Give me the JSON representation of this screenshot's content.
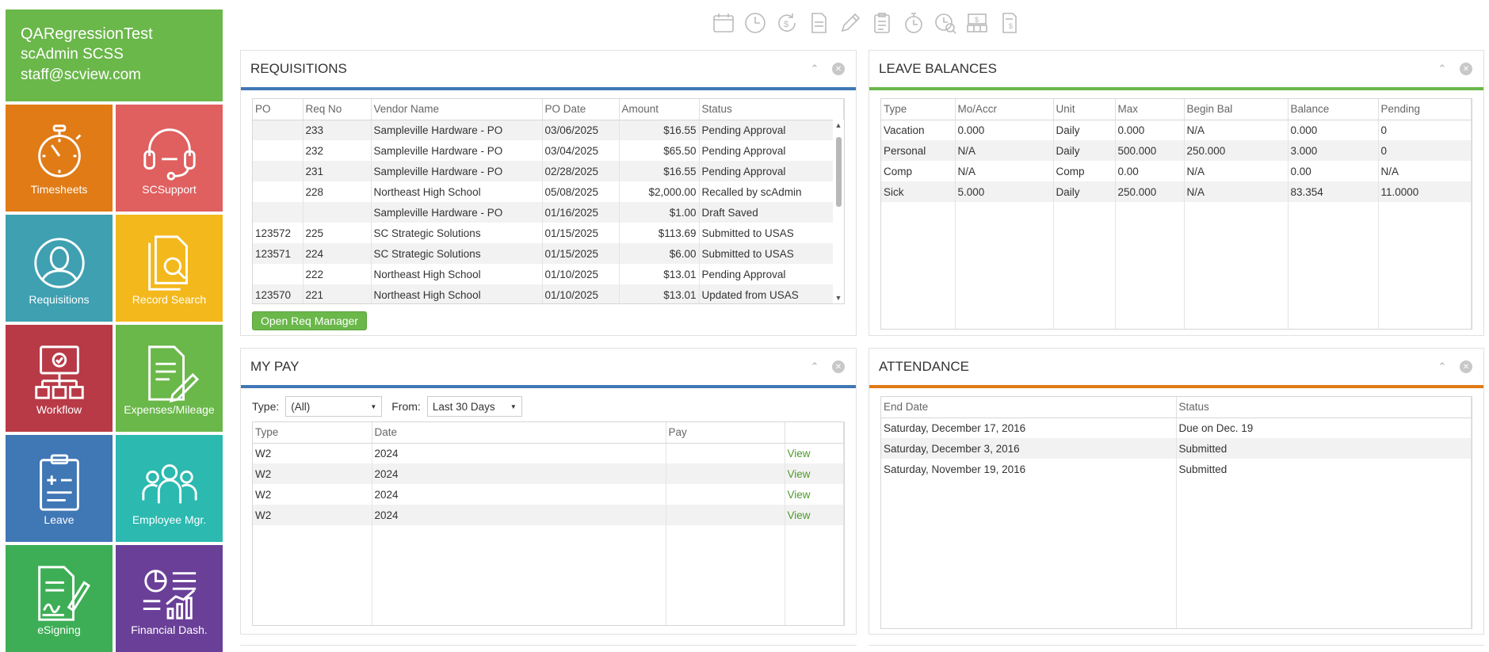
{
  "user": {
    "org": "QARegressionTest",
    "name": "scAdmin SCSS",
    "email": "staff@scview.com"
  },
  "tiles": [
    {
      "label": "Timesheets",
      "color": "#e07b16",
      "icon": "stopwatch-icon"
    },
    {
      "label": "SCSupport",
      "color": "#e05f5f",
      "icon": "headset-icon"
    },
    {
      "label": "Requisitions",
      "color": "#3ea0b1",
      "icon": "person-icon"
    },
    {
      "label": "Record Search",
      "color": "#f3b81c",
      "icon": "document-search-icon"
    },
    {
      "label": "Workflow",
      "color": "#b83a46",
      "icon": "workflow-icon"
    },
    {
      "label": "Expenses/Mileage",
      "color": "#6ab74a",
      "icon": "document-pen-icon"
    },
    {
      "label": "Leave",
      "color": "#4077b5",
      "icon": "clipboard-icon"
    },
    {
      "label": "Employee Mgr.",
      "color": "#2bb9b0",
      "icon": "group-icon"
    },
    {
      "label": "eSigning",
      "color": "#3dae55",
      "icon": "signature-icon"
    },
    {
      "label": "Financial Dash.",
      "color": "#6a3f98",
      "icon": "dashboard-icon"
    }
  ],
  "toolbar_icons": [
    "calendar-icon",
    "clock-icon",
    "refresh-dollar-icon",
    "document-icon",
    "pencil-icon",
    "clipboard-list-icon",
    "stopwatch-icon",
    "clock-search-icon",
    "cash-register-icon",
    "receipt-icon"
  ],
  "requisitions": {
    "title": "REQUISITIONS",
    "bar_color": "#4077b5",
    "columns": [
      "PO",
      "Req No",
      "Vendor Name",
      "PO Date",
      "Amount",
      "Status"
    ],
    "rows": [
      {
        "po": "",
        "req": "233",
        "vendor": "Sampleville Hardware - PO",
        "date": "03/06/2025",
        "amount": "$16.55",
        "status": "Pending Approval"
      },
      {
        "po": "",
        "req": "232",
        "vendor": "Sampleville Hardware - PO",
        "date": "03/04/2025",
        "amount": "$65.50",
        "status": "Pending Approval"
      },
      {
        "po": "",
        "req": "231",
        "vendor": "Sampleville Hardware - PO",
        "date": "02/28/2025",
        "amount": "$16.55",
        "status": "Pending Approval"
      },
      {
        "po": "",
        "req": "228",
        "vendor": "Northeast High School",
        "date": "05/08/2025",
        "amount": "$2,000.00",
        "status": "Recalled by scAdmin"
      },
      {
        "po": "",
        "req": "",
        "vendor": "Sampleville Hardware - PO",
        "date": "01/16/2025",
        "amount": "$1.00",
        "status": "Draft Saved"
      },
      {
        "po": "123572",
        "req": "225",
        "vendor": "SC Strategic Solutions",
        "date": "01/15/2025",
        "amount": "$113.69",
        "status": "Submitted to USAS"
      },
      {
        "po": "123571",
        "req": "224",
        "vendor": "SC Strategic Solutions",
        "date": "01/15/2025",
        "amount": "$6.00",
        "status": "Submitted to USAS"
      },
      {
        "po": "",
        "req": "222",
        "vendor": "Northeast High School",
        "date": "01/10/2025",
        "amount": "$13.01",
        "status": "Pending Approval"
      },
      {
        "po": "123570",
        "req": "221",
        "vendor": "Northeast High School",
        "date": "01/10/2025",
        "amount": "$13.01",
        "status": "Updated from USAS"
      }
    ],
    "button": "Open Req Manager"
  },
  "leave_balances": {
    "title": "LEAVE BALANCES",
    "bar_color": "#6ab74a",
    "columns": [
      "Type",
      "Mo/Accr",
      "Unit",
      "Max",
      "Begin Bal",
      "Balance",
      "Pending"
    ],
    "rows": [
      [
        "Vacation",
        "0.000",
        "Daily",
        "0.000",
        "N/A",
        "0.000",
        "0"
      ],
      [
        "Personal",
        "N/A",
        "Daily",
        "500.000",
        "250.000",
        "3.000",
        "0"
      ],
      [
        "Comp",
        "N/A",
        "Comp",
        "0.00",
        "N/A",
        "0.00",
        "N/A"
      ],
      [
        "Sick",
        "5.000",
        "Daily",
        "250.000",
        "N/A",
        "83.354",
        "11.0000"
      ]
    ]
  },
  "my_pay": {
    "title": "MY PAY",
    "bar_color": "#4077b5",
    "type_label": "Type:",
    "type_value": "(All)",
    "from_label": "From:",
    "from_value": "Last 30 Days",
    "columns": [
      "Type",
      "Date",
      "Pay",
      ""
    ],
    "rows": [
      {
        "type": "W2",
        "date": "2024",
        "pay": "",
        "action": "View"
      },
      {
        "type": "W2",
        "date": "2024",
        "pay": "",
        "action": "View"
      },
      {
        "type": "W2",
        "date": "2024",
        "pay": "",
        "action": "View"
      },
      {
        "type": "W2",
        "date": "2024",
        "pay": "",
        "action": "View"
      }
    ]
  },
  "attendance": {
    "title": "ATTENDANCE",
    "bar_color": "#e07b16",
    "columns": [
      "End Date",
      "Status"
    ],
    "rows": [
      [
        "Saturday, December 17, 2016",
        "Due on Dec. 19"
      ],
      [
        "Saturday, December 3, 2016",
        "Submitted"
      ],
      [
        "Saturday, November 19, 2016",
        "Submitted"
      ]
    ]
  }
}
